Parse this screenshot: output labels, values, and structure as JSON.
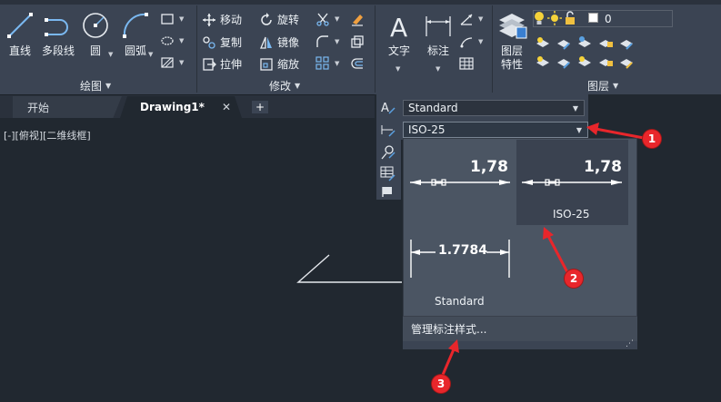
{
  "ribbon": {
    "draw_panel": {
      "label": "绘图",
      "buttons": {
        "line": "直线",
        "polyline": "多段线",
        "circle": "圆",
        "arc": "圆弧"
      }
    },
    "modify_panel": {
      "label": "修改",
      "buttons": {
        "move": "移动",
        "rotate": "旋转",
        "copy": "复制",
        "mirror": "镜像",
        "stretch": "拉伸",
        "scale": "缩放"
      }
    },
    "annotation_panel": {
      "text": "文字",
      "dimension": "标注",
      "text_style": "Standard",
      "dim_style": "ISO-25"
    },
    "layers_panel": {
      "label": "图层",
      "properties_line1": "图层",
      "properties_line2": "特性",
      "current_layer": "0"
    }
  },
  "tabs": {
    "start": "开始",
    "drawing": "Drawing1*",
    "close": "✕",
    "add": "+"
  },
  "viewport": {
    "label": "[-][俯视][二维线框]"
  },
  "dim_dropdown": {
    "items": [
      {
        "name": "Standard",
        "preview_value": "1.7784"
      },
      {
        "name": "ISO-25",
        "preview_value": "1,78"
      }
    ],
    "top_left_preview_value": "1,78",
    "manage": "管理标注样式..."
  },
  "badges": [
    "1",
    "2",
    "3"
  ],
  "colors": {
    "ribbon_bg": "#3b4453",
    "canvas_bg": "#212830",
    "badge_red": "#e8262b",
    "accent_blue": "#5aa0e0"
  }
}
